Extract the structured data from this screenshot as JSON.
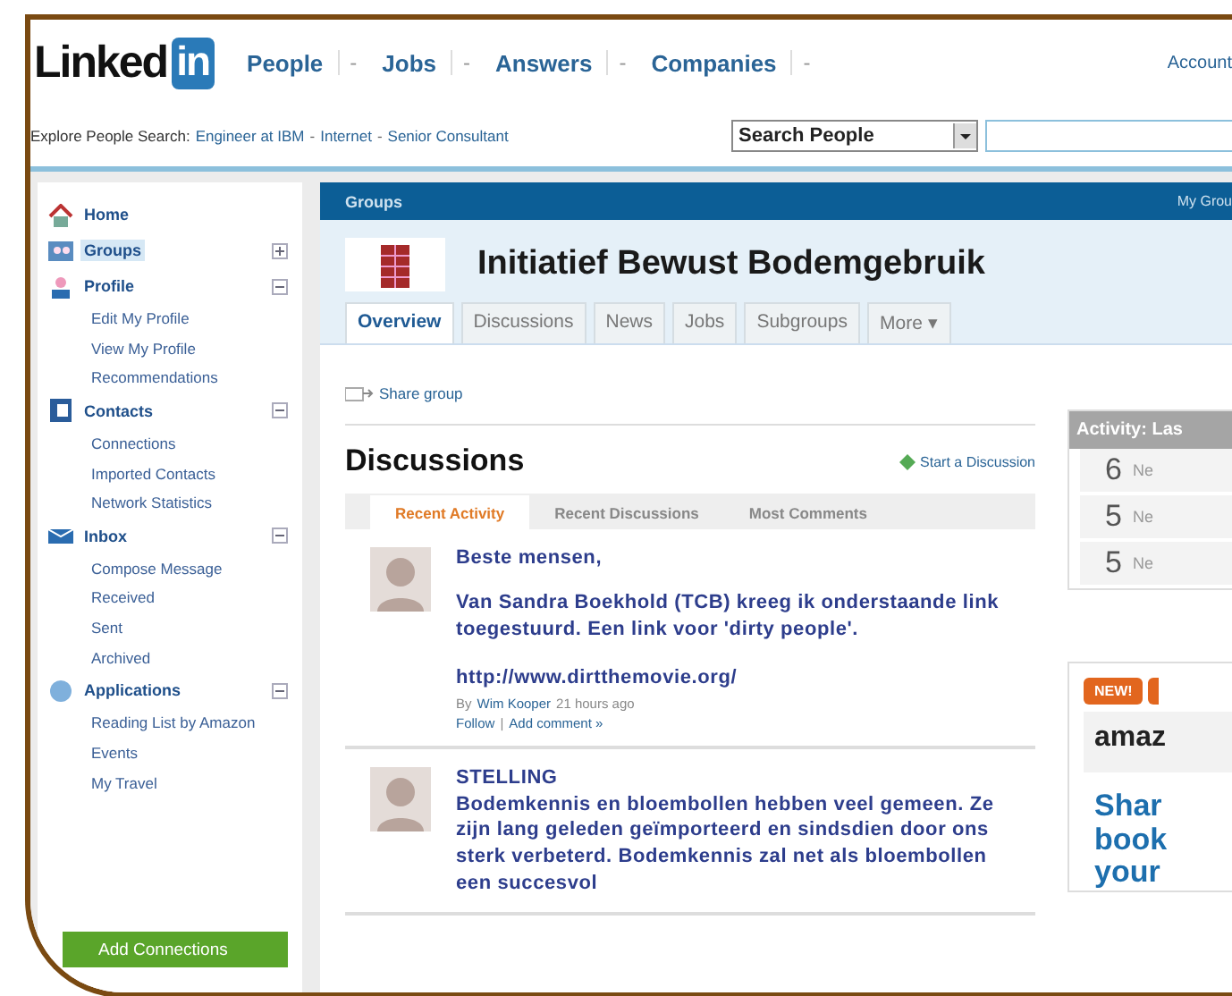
{
  "header": {
    "logo_text": "Linked",
    "logo_badge": "in",
    "nav": [
      {
        "label": "People",
        "caret": "-"
      },
      {
        "label": "Jobs",
        "caret": "-"
      },
      {
        "label": "Answers",
        "caret": "-"
      },
      {
        "label": "Companies",
        "caret": "-"
      }
    ],
    "account": "Account"
  },
  "search_bar": {
    "explore_label": "Explore People Search:",
    "explore_links": [
      "Engineer at IBM",
      "Internet",
      "Senior Consultant"
    ],
    "separator": "-",
    "select": "Search People"
  },
  "sidebar": {
    "items": [
      {
        "label": "Home",
        "kind": "home",
        "selected": false
      },
      {
        "label": "Groups",
        "kind": "groups",
        "selected": true,
        "expanded": false
      },
      {
        "label": "Profile",
        "kind": "profile",
        "selected": false,
        "expanded": true,
        "children": [
          "Edit My Profile",
          "View My Profile",
          "Recommendations"
        ]
      },
      {
        "label": "Contacts",
        "kind": "contacts",
        "selected": false,
        "expanded": true,
        "children": [
          "Connections",
          "Imported Contacts",
          "Network Statistics"
        ]
      },
      {
        "label": "Inbox",
        "kind": "inbox",
        "selected": false,
        "expanded": true,
        "children": [
          "Compose Message",
          "Received",
          "Sent",
          "Archived"
        ]
      },
      {
        "label": "Applications",
        "kind": "apps",
        "selected": false,
        "expanded": true,
        "children": [
          "Reading List by Amazon",
          "Events",
          "My Travel"
        ]
      }
    ],
    "button": "Add Connections"
  },
  "group_bar": {
    "title": "Groups",
    "right": "My Grou"
  },
  "group": {
    "name": "Initiatief Bewust Bodemgebruik",
    "tabs": [
      {
        "label": "Overview",
        "selected": true
      },
      {
        "label": "Discussions",
        "selected": false
      },
      {
        "label": "News",
        "selected": false
      },
      {
        "label": "Jobs",
        "selected": false
      },
      {
        "label": "Subgroups",
        "selected": false
      },
      {
        "label": "More ▾",
        "selected": false
      }
    ]
  },
  "share": "Share group",
  "discussions": {
    "title": "Discussions",
    "start": "Start a Discussion",
    "tabs": [
      {
        "label": "Recent Activity",
        "selected": true
      },
      {
        "label": "Recent Discussions",
        "selected": false
      },
      {
        "label": "Most Comments",
        "selected": false
      }
    ],
    "posts": [
      {
        "title": "Beste mensen,",
        "paragraphs": [
          "Van Sandra Boekhold (TCB) kreeg ik onderstaande link toegestuurd. Een link voor 'dirty people'.",
          "http://www.dirtthemovie.org/"
        ],
        "by": "By",
        "author": "Wim Kooper",
        "time": "21 hours ago",
        "actions": [
          "Follow",
          "Add comment »"
        ],
        "action_separator": "|"
      },
      {
        "title": "STELLING",
        "paragraphs": [
          "Bodemkennis en bloembollen hebben veel gemeen. Ze zijn lang geleden geïmporteerd en sindsdien door ons sterk verbeterd. Bodemkennis zal net als bloembollen een succesvol"
        ]
      }
    ]
  },
  "activity": {
    "title": "Activity: Las",
    "rows": [
      {
        "count": "6",
        "label": "Ne"
      },
      {
        "count": "5",
        "label": "Ne"
      },
      {
        "count": "5",
        "label": "Ne"
      }
    ]
  },
  "promo": {
    "badge": "NEW!",
    "logo": "amaz",
    "lines": [
      "Shar",
      "book",
      "your"
    ]
  }
}
